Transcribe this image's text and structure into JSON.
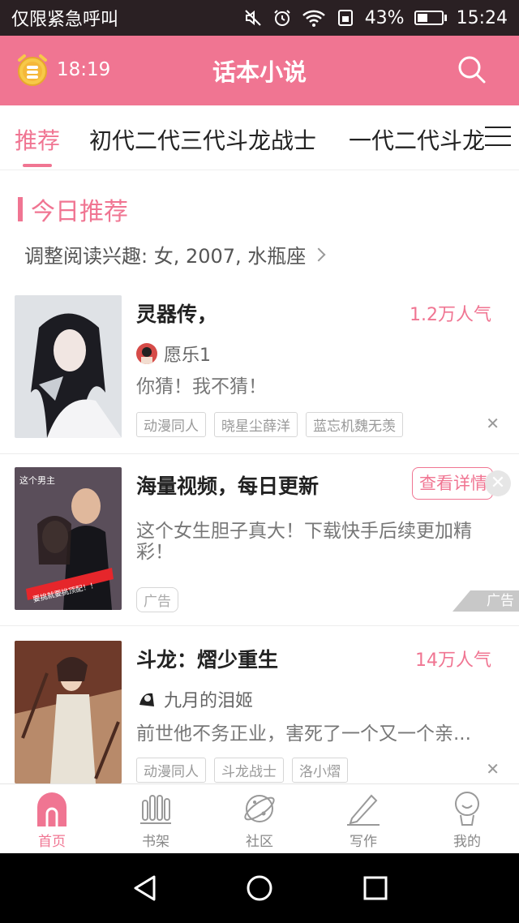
{
  "status_bar": {
    "carrier": "仅限紧急呼叫",
    "battery_percent": "43%",
    "battery_level": 0.43,
    "time": "15:24",
    "icons": [
      "mute-icon",
      "alarm-clock-icon",
      "wifi-icon",
      "sim-icon",
      "battery-icon"
    ]
  },
  "header": {
    "alarm_time": "18:19",
    "title": "话本小说",
    "search_icon": "search-icon",
    "accent": "#f07592"
  },
  "tabs": {
    "items": [
      "推荐",
      "初代二代三代斗龙战士",
      "一代二代斗龙"
    ],
    "active_index": 0,
    "menu_icon": "hamburger-icon"
  },
  "section": {
    "title": "今日推荐",
    "interest": "调整阅读兴趣: 女, 2007, 水瓶座"
  },
  "cards": [
    {
      "title": "灵器传，",
      "popularity": "1.2万人气",
      "author": "愿乐1",
      "description": "你猜！我不猜！",
      "tags": [
        "动漫同人",
        "晓星尘薛洋",
        "蓝忘机魏无羡"
      ]
    },
    {
      "title": "海量视频，每日更新",
      "button": "查看详情",
      "description": "这个女生胆子真大！下载快手后续更加精彩！",
      "ad_tag": "广告",
      "ad_mark": "广告",
      "cover_text_1": "这个男主",
      "cover_text_2": "要挑就要挑顶配！！"
    },
    {
      "title": "斗龙：熠少重生",
      "popularity": "14万人气",
      "author": "九月的泪姬",
      "description": "前世他不务正业，害死了一个又一个亲...",
      "tags": [
        "动漫同人",
        "斗龙战士",
        "洛小熠"
      ]
    }
  ],
  "bottom_nav": {
    "items": [
      {
        "label": "首页",
        "icon": "home-icon"
      },
      {
        "label": "书架",
        "icon": "bookshelf-icon"
      },
      {
        "label": "社区",
        "icon": "planet-icon"
      },
      {
        "label": "写作",
        "icon": "pen-icon"
      },
      {
        "label": "我的",
        "icon": "profile-icon"
      }
    ],
    "active_index": 0
  }
}
